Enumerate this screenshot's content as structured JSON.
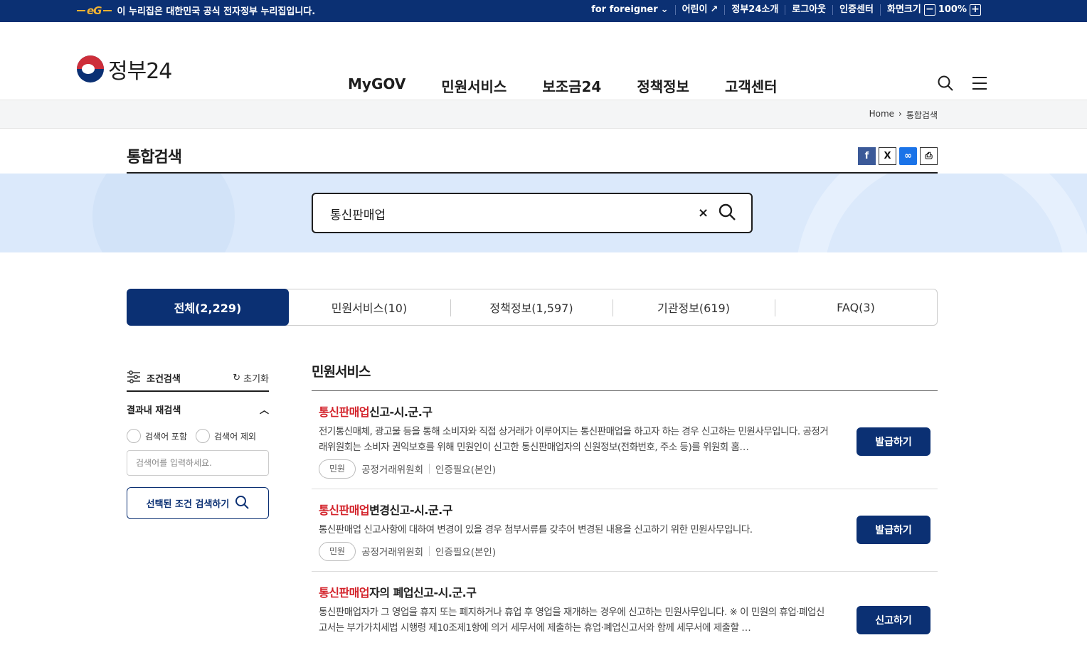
{
  "topbar": {
    "notice": "이 누리집은 대한민국 공식 전자정부 누리집입니다.",
    "eg": "eG",
    "links": [
      "for foreigner",
      "어린이",
      "정부24소개",
      "로그아웃",
      "인증센터",
      "화면크기"
    ],
    "zoom": "100%"
  },
  "header": {
    "logo": "정부24",
    "nav": [
      "MyGOV",
      "민원서비스",
      "보조금24",
      "정책정보",
      "고객센터"
    ]
  },
  "breadcrumb": [
    "Home",
    "통합검색"
  ],
  "page": {
    "title": "통합검색"
  },
  "search": {
    "value": "통신판매업",
    "clear": "×"
  },
  "tabs": [
    {
      "label": "전체(2,229)"
    },
    {
      "label": "민원서비스(10)"
    },
    {
      "label": "정책정보(1,597)"
    },
    {
      "label": "기관정보(619)"
    },
    {
      "label": "FAQ(3)"
    }
  ],
  "sidebar": {
    "title": "조건검색",
    "reset": "초기화",
    "refine": "결과내 재검색",
    "include": "검색어 포함",
    "exclude": "검색어 제외",
    "placeholder": "검색어를 입력하세요.",
    "button": "선택된 조건 검색하기"
  },
  "results": {
    "section": "민원서비스",
    "items": [
      {
        "hl": "통신판매업",
        "rest": "신고-시.군.구",
        "desc": "전기통신매체, 광고물 등을 통해 소비자와 직접 상거래가 이루어지는 통신판매업을 하고자 하는 경우 신고하는 민원사무입니다. 공정거래위원회는 소비자 권익보호를 위해 민원인이 신고한 통신판매업자의 신원정보(전화번호, 주소 등)를 위원회 홈…",
        "badge": "민원",
        "org": "공정거래위원회",
        "auth": "인증필요(본인)",
        "action": "발급하기"
      },
      {
        "hl": "통신판매업",
        "rest": "변경신고-시.군.구",
        "desc": "통신판매업 신고사항에 대하여 변경이 있을 경우 첨부서류를 갖추어 변경된 내용을 신고하기 위한 민원사무입니다.",
        "badge": "민원",
        "org": "공정거래위원회",
        "auth": "인증필요(본인)",
        "action": "발급하기"
      },
      {
        "hl": "통신판매업",
        "rest": "자의 폐업신고-시.군.구",
        "desc": "통신판매업자가 그 영업을 휴지 또는 폐지하거나 휴업 후 영업을 재개하는 경우에 신고하는 민원사무입니다. ※ 이 민원의 휴업·폐업신고서는 부가가치세법 시행령 제10조제1항에 의거 세무서에 제출하는 휴업·폐업신고서와 함께 세무서에 제출할 …",
        "badge": "",
        "org": "",
        "auth": "",
        "action": "신고하기"
      }
    ]
  }
}
